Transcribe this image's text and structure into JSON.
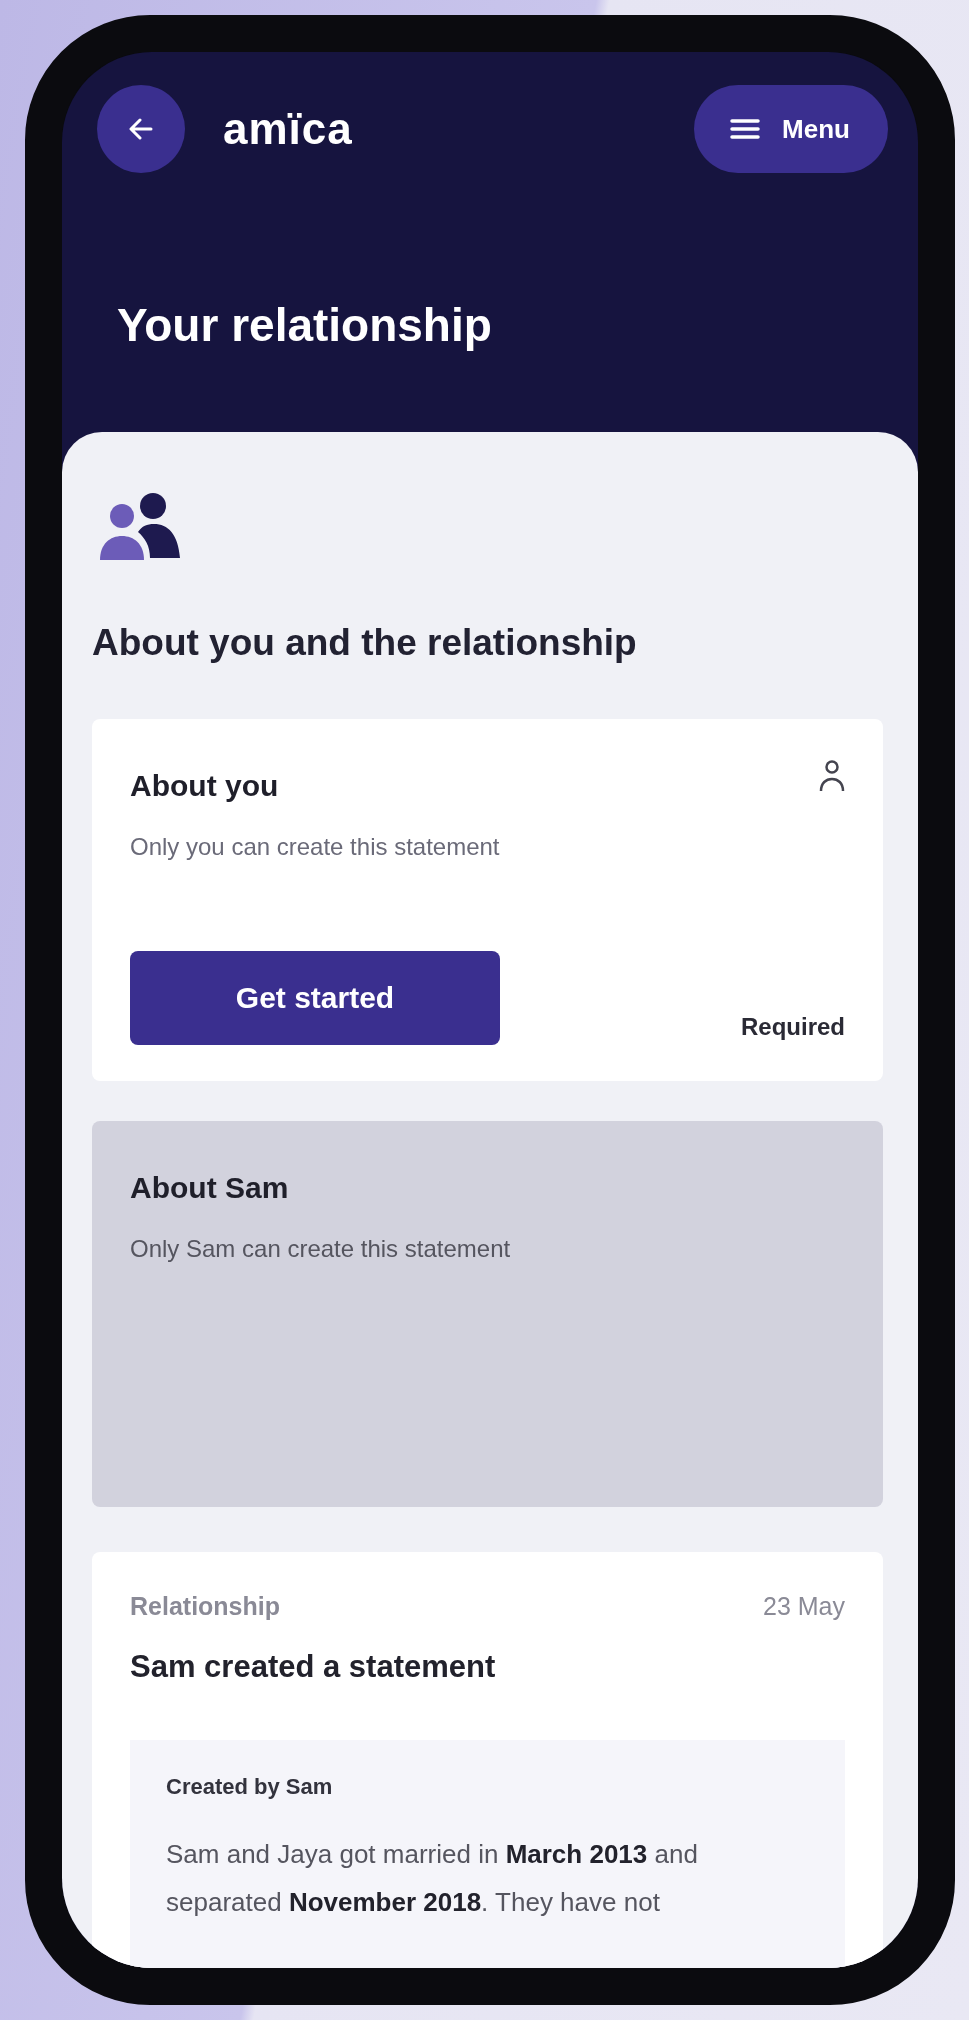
{
  "header": {
    "logo": "amïca",
    "menu_button": "Menu"
  },
  "page_title": "Your relationship",
  "section": {
    "title": "About you and the relationship"
  },
  "cards": [
    {
      "kind": "action",
      "title": "About you",
      "description": "Only you can create this statement",
      "button": "Get started",
      "status": "Required"
    },
    {
      "kind": "locked",
      "title": "About Sam",
      "description": "Only Sam can create this statement"
    }
  ],
  "activity": {
    "category": "Relationship",
    "date": "23 May",
    "title": "Sam created a statement",
    "statement": {
      "author": "Created by Sam",
      "text": "Sam and Jaya got married in **March 2013** and separated **November 2018**. They have not"
    }
  }
}
